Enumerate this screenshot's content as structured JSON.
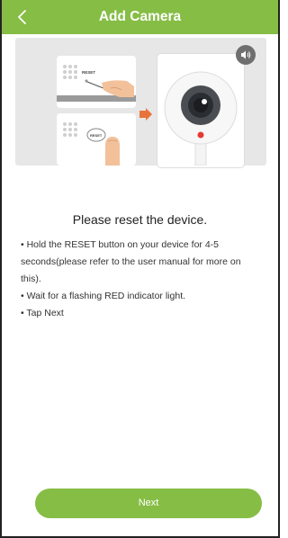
{
  "header": {
    "title": "Add Camera",
    "back_icon": "chevron-left-icon",
    "bg_color": "#86bd45"
  },
  "illustration": {
    "reset_label_top": "RESET",
    "reset_label_bottom": "RESET",
    "arrow_color": "#e8733a",
    "indicator_color": "#e53935",
    "speaker_icon": "speaker-icon"
  },
  "main": {
    "heading": "Please reset the device.",
    "bullets": [
      "• Hold the RESET button on your device for 4-5 seconds(please refer to the user manual for more on this).",
      "• Wait for a flashing RED indicator light.",
      "• Tap Next"
    ]
  },
  "footer": {
    "next_label": "Next"
  }
}
